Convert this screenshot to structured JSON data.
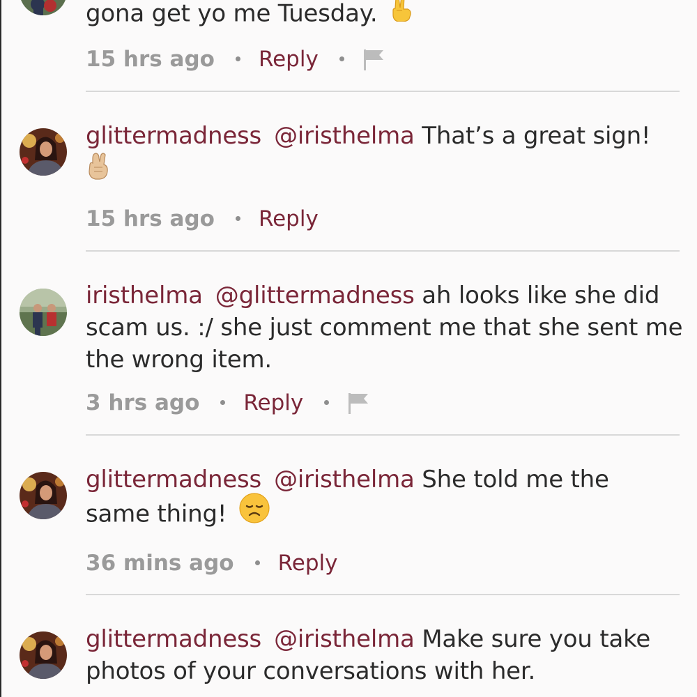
{
  "comments": [
    {
      "username": "",
      "mention": "",
      "text": "gona get yo me Tuesday.",
      "emoji": "victory-hand-emoji",
      "time": "15 hrs ago",
      "reply": "Reply",
      "has_flag": true
    },
    {
      "username": "glittermadness",
      "mention": "@iristhelma",
      "text": "That’s a great sign!",
      "emoji": "crossed-fingers-emoji",
      "time": "15 hrs ago",
      "reply": "Reply",
      "has_flag": false
    },
    {
      "username": "iristhelma",
      "mention": "@glittermadness",
      "text": "ah looks like she did scam us. :/ she just comment me that she sent me the wrong item.",
      "time": "3 hrs ago",
      "reply": "Reply",
      "has_flag": true
    },
    {
      "username": "glittermadness",
      "mention": "@iristhelma",
      "text_line1": "She told me the",
      "text_line2": "same thing!",
      "emoji": "disappointed-face-emoji",
      "time": "36 mins ago",
      "reply": "Reply",
      "has_flag": false
    },
    {
      "username": "glittermadness",
      "mention": "@iristhelma",
      "text_line1": "Make sure you take",
      "text_line2": "photos of your conversations with her."
    }
  ],
  "colors": {
    "accent": "#7a2638",
    "muted": "#9a9a9a",
    "text": "#2b2b2b",
    "divider": "#d8d8d8",
    "background": "#fbfafa"
  }
}
